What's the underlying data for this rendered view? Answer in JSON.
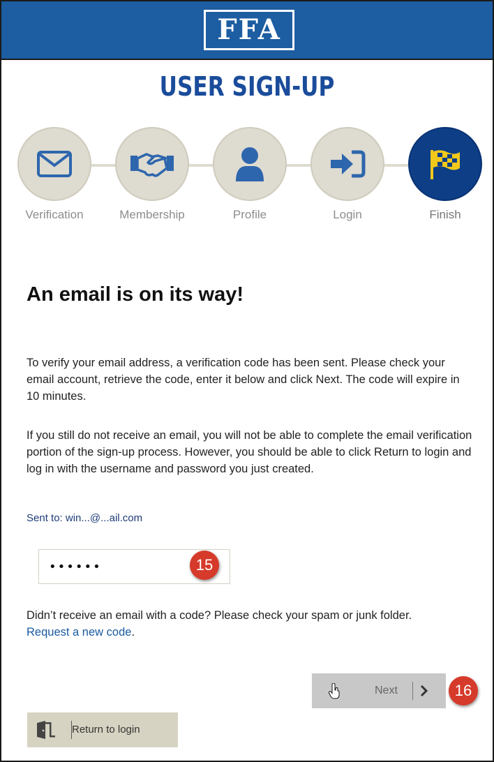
{
  "header": {
    "logo_text": "FFA",
    "brand_color": "#1d5da1"
  },
  "page": {
    "title": "USER SIGN-UP",
    "title_color": "#1b4c9b"
  },
  "steps": [
    {
      "label": "Verification",
      "icon": "envelope-icon",
      "active": false
    },
    {
      "label": "Membership",
      "icon": "handshake-icon",
      "active": false
    },
    {
      "label": "Profile",
      "icon": "user-icon",
      "active": false
    },
    {
      "label": "Login",
      "icon": "sign-in-icon",
      "active": false
    },
    {
      "label": "Finish",
      "icon": "checkered-flag-icon",
      "active": true
    }
  ],
  "content": {
    "heading": "An email is on its way!",
    "paragraph1": "To verify your email address, a verification code has been sent. Please check your email account, retrieve the code, enter it below and click Next. The code will expire in 10 minutes.",
    "paragraph2": "If you still do not receive an email, you will not be able to complete the email verification portion of the sign-up process. However, you should be able to click Return to login and log in with the username and password you just created.",
    "sent_to": "Sent to: win...@...ail.com",
    "code_value": "••••••",
    "help_text": "Didn’t receive an email with a code? Please check your spam or junk folder.",
    "request_link": "Request a new code",
    "request_link_suffix": "."
  },
  "annotations": {
    "badge_code": "15",
    "badge_next": "16",
    "badge_color": "#d63a2a"
  },
  "buttons": {
    "next_label": "Next",
    "return_label": "Return to login"
  }
}
